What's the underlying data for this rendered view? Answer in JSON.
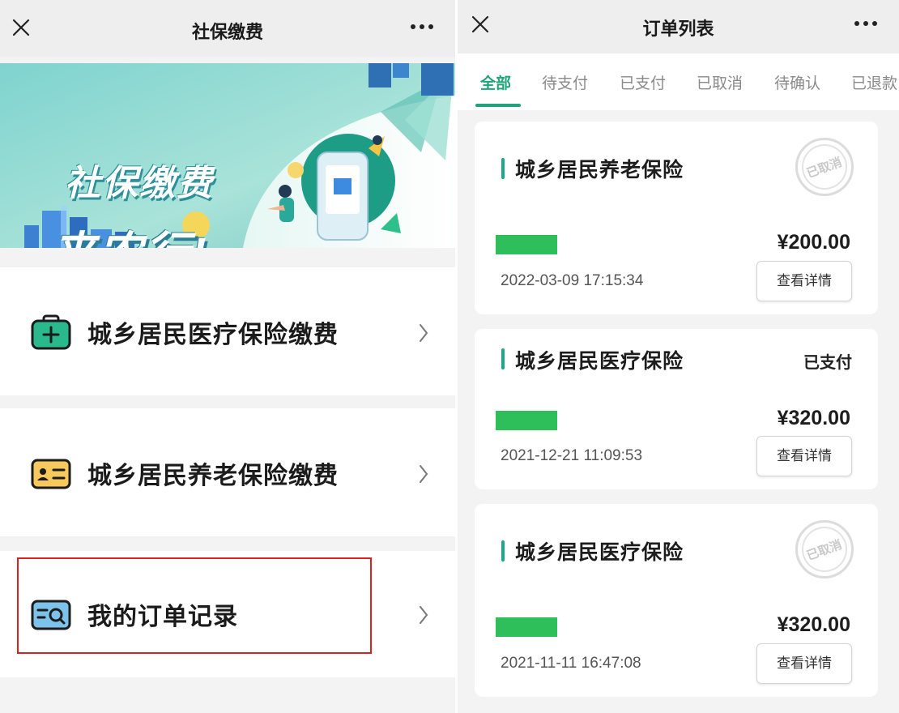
{
  "left": {
    "title": "社保缴费",
    "banner": {
      "headline_line1": "社保缴费",
      "headline_line2": "来农行!"
    },
    "menu": [
      {
        "label": "城乡居民医疗保险缴费",
        "icon": "medical-kit-icon"
      },
      {
        "label": "城乡居民养老保险缴费",
        "icon": "id-card-icon"
      },
      {
        "label": "我的订单记录",
        "icon": "order-search-icon"
      }
    ]
  },
  "right": {
    "title": "订单列表",
    "tabs": [
      "全部",
      "待支付",
      "已支付",
      "已取消",
      "待确认",
      "已退款"
    ],
    "active_tab": "全部",
    "orders": [
      {
        "title": "城乡居民养老保险",
        "status": "已取消",
        "status_display": "stamp",
        "amount": "¥200.00",
        "time": "2022-03-09 17:15:34",
        "detail_label": "查看详情"
      },
      {
        "title": "城乡居民医疗保险",
        "status": "已支付",
        "status_display": "text",
        "amount": "¥320.00",
        "time": "2021-12-21 11:09:53",
        "detail_label": "查看详情"
      },
      {
        "title": "城乡居民医疗保险",
        "status": "已取消",
        "status_display": "stamp",
        "amount": "¥320.00",
        "time": "2021-11-11 16:47:08",
        "detail_label": "查看详情"
      }
    ]
  },
  "colors": {
    "accent_green": "#1ea37a",
    "redaction_green": "#2fbf5a",
    "highlight_red": "#e02020"
  }
}
